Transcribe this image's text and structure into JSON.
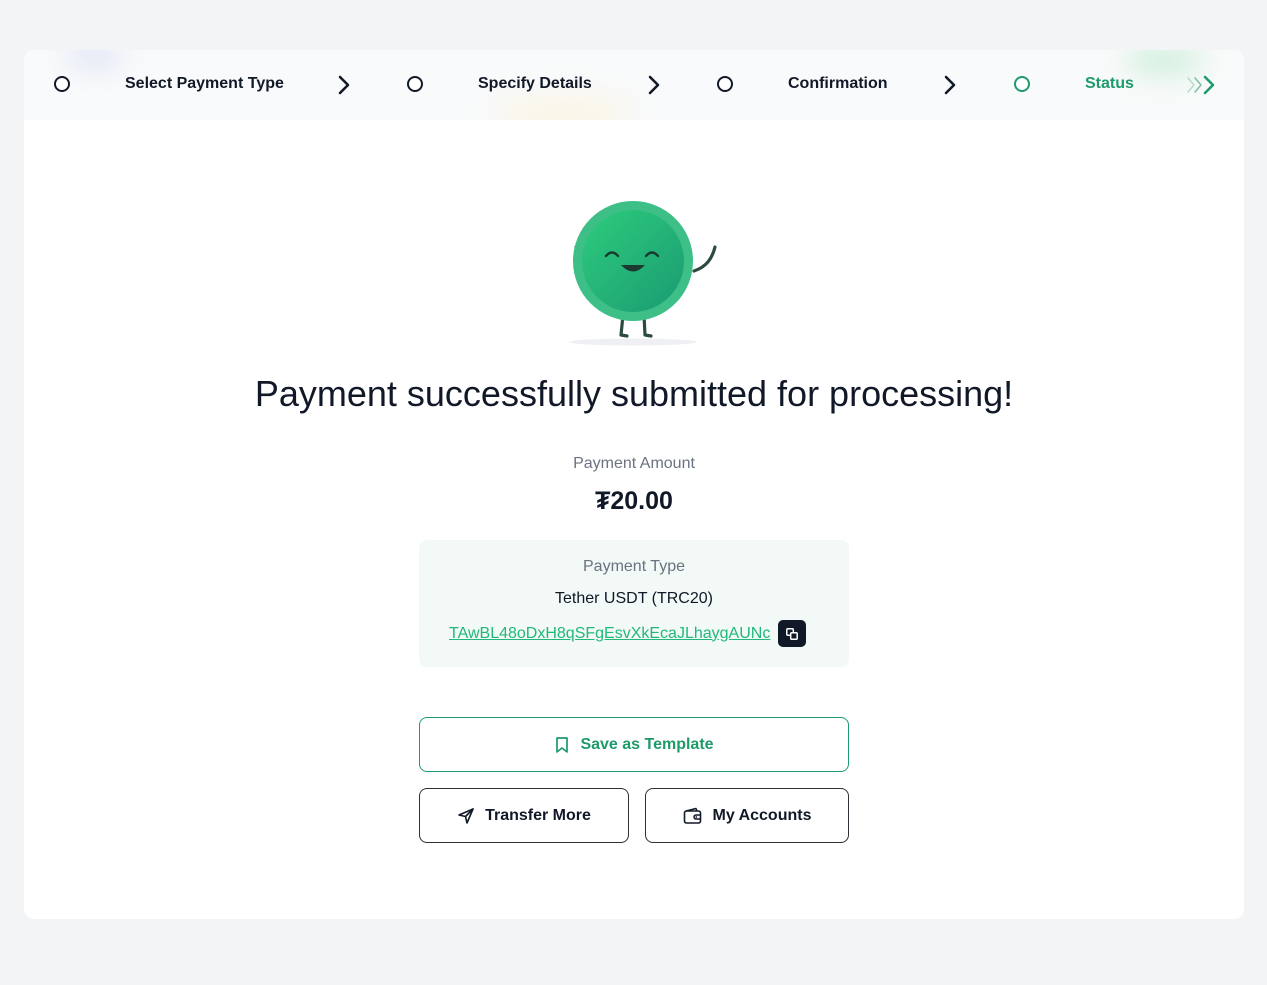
{
  "stepper": {
    "steps": [
      {
        "label": "Select Payment Type"
      },
      {
        "label": "Specify Details"
      },
      {
        "label": "Confirmation"
      },
      {
        "label": "Status",
        "active": true
      }
    ]
  },
  "status": {
    "title": "Payment successfully submitted for processing!"
  },
  "payment": {
    "amount_label": "Payment Amount",
    "amount_value": "₮20.00",
    "type_label": "Payment Type",
    "type_value": "Tether USDT (TRC20)",
    "address": "TAwBL48oDxH8qSFgEsvXkEcaJLhaygAUNc"
  },
  "actions": {
    "save_template": "Save as Template",
    "transfer_more": "Transfer More",
    "my_accounts": "My Accounts"
  },
  "colors": {
    "accent": "#1f9a6a",
    "link": "#22b87a",
    "text": "#111827",
    "muted": "#6b7280",
    "panel": "#f2f9f6",
    "background": "#f3f4f6"
  },
  "icons": {
    "step_marker": "circle-outline-icon",
    "step_separator": "chevron-right-icon",
    "more": "double-chevron-right-icon",
    "copy": "copy-icon",
    "save": "bookmark-icon",
    "transfer": "send-icon",
    "accounts": "wallet-icon",
    "illustration": "smiling-coin-mascot"
  }
}
